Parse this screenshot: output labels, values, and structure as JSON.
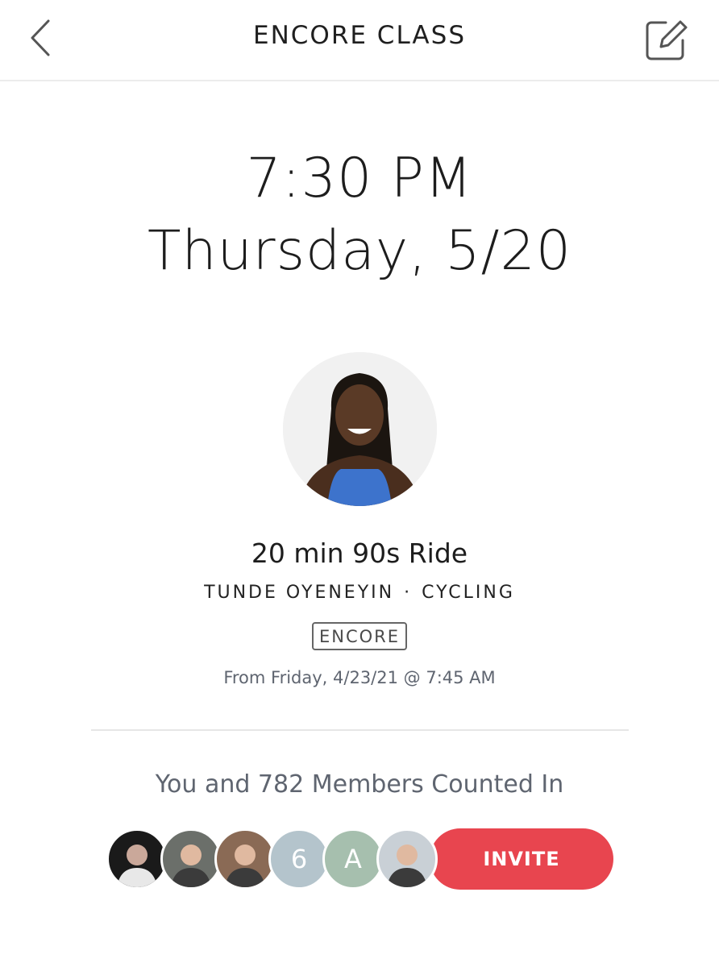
{
  "header": {
    "title": "ENCORE CLASS",
    "back_icon": "chevron-left-icon",
    "edit_icon": "edit-icon"
  },
  "schedule": {
    "time": "7:30 PM",
    "date": "Thursday, 5/20"
  },
  "class": {
    "title": "20 min 90s Ride",
    "instructor": "TUNDE OYENEYIN",
    "separator": "·",
    "category": "CYCLING",
    "badge": "ENCORE",
    "from_text": "From Friday, 4/23/21 @ 7:45 AM"
  },
  "members": {
    "counted_text": "You and 782 Members Counted In",
    "avatars": [
      {
        "type": "photo",
        "color": "#1a1a1a"
      },
      {
        "type": "photo",
        "color": "#6b6f6a"
      },
      {
        "type": "photo",
        "color": "#8a6a55"
      },
      {
        "type": "initial",
        "initial": "6",
        "color": "#b4c4cc"
      },
      {
        "type": "initial",
        "initial": "A",
        "color": "#a6bfae"
      },
      {
        "type": "photo",
        "color": "#c9d0d6"
      }
    ],
    "invite_label": "INVITE"
  },
  "colors": {
    "accent": "#e8454f",
    "muted_text": "#5f6570"
  }
}
